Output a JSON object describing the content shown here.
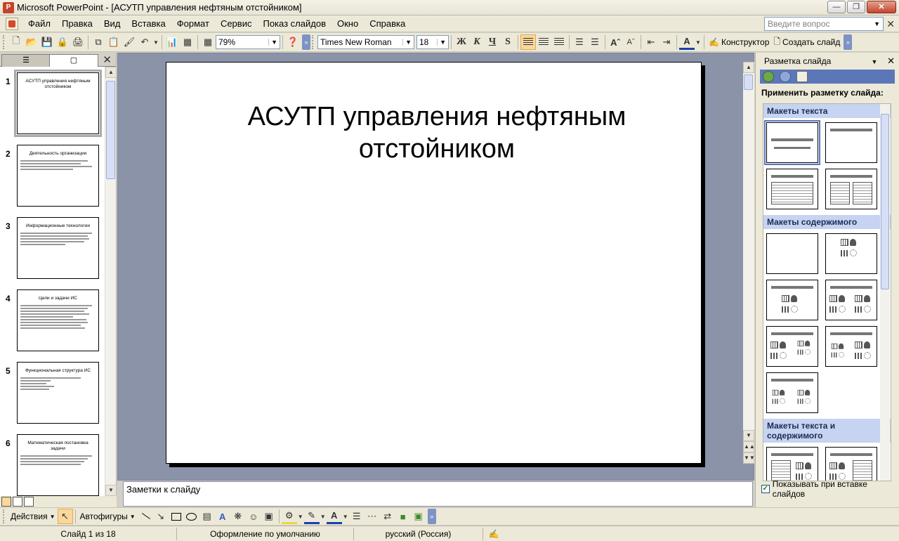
{
  "window": {
    "title": "Microsoft PowerPoint - [АСУТП управления нефтяным отстойником]",
    "app_icon_label": "P"
  },
  "menu": {
    "items": [
      "Файл",
      "Правка",
      "Вид",
      "Вставка",
      "Формат",
      "Сервис",
      "Показ слайдов",
      "Окно",
      "Справка"
    ],
    "ask_placeholder": "Введите вопрос"
  },
  "toolbar": {
    "zoom": "79%",
    "font": "Times New Roman",
    "font_size": "18",
    "bold": "Ж",
    "italic": "К",
    "underline": "Ч",
    "shadow": "S",
    "designer": "Конструктор",
    "new_slide": "Создать слайд"
  },
  "slides_pane": {
    "thumbs": [
      {
        "num": "1",
        "title": "АСУТП управления нефтяным отстойником",
        "lines": 0
      },
      {
        "num": "2",
        "title": "Деятельность организации",
        "lines": 4
      },
      {
        "num": "3",
        "title": "Информационные технологии",
        "lines": 5
      },
      {
        "num": "4",
        "title": "Цели и задачи ИС",
        "lines": 9
      },
      {
        "num": "5",
        "title": "Функциональная структура ИС",
        "lines": 5
      },
      {
        "num": "6",
        "title": "Математическая постановка задачи",
        "lines": 4
      }
    ]
  },
  "slide": {
    "title": "АСУТП управления нефтяным отстойником"
  },
  "notes": {
    "placeholder": "Заметки к слайду"
  },
  "task_pane": {
    "header": "Разметка слайда",
    "apply": "Применить разметку слайда:",
    "sections": {
      "text": "Макеты текста",
      "content": "Макеты содержимого",
      "text_content": "Макеты текста и содержимого"
    },
    "footer_checkbox": "Показывать при вставке слайдов"
  },
  "drawbar": {
    "actions": "Действия",
    "autoshapes": "Автофигуры"
  },
  "status": {
    "slide": "Слайд 1 из 18",
    "design": "Оформление по умолчанию",
    "language": "русский (Россия)"
  },
  "colors": {
    "accent": "#5b77b8",
    "workspace": "#8b93a9",
    "chrome": "#ece9d8"
  }
}
